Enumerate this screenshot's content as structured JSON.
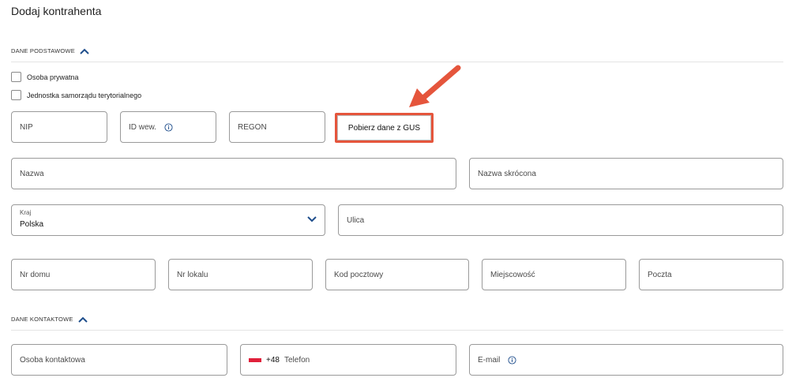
{
  "page": {
    "title": "Dodaj kontrahenta"
  },
  "sections": {
    "basic": {
      "label": "DANE PODSTAWOWE"
    },
    "contact": {
      "label": "DANE KONTAKTOWE"
    }
  },
  "checkboxes": {
    "private_person": {
      "label": "Osoba prywatna",
      "checked": false
    },
    "local_gov_unit": {
      "label": "Jednostka samorządu terytorialnego",
      "checked": false
    }
  },
  "fields": {
    "nip": {
      "placeholder": "NIP",
      "value": ""
    },
    "internal_id": {
      "placeholder": "ID wew.",
      "value": ""
    },
    "regon": {
      "placeholder": "REGON",
      "value": ""
    },
    "name": {
      "placeholder": "Nazwa",
      "value": ""
    },
    "short_name": {
      "placeholder": "Nazwa skrócona",
      "value": ""
    },
    "country": {
      "label": "Kraj",
      "value": "Polska"
    },
    "street": {
      "placeholder": "Ulica",
      "value": ""
    },
    "house_no": {
      "placeholder": "Nr domu",
      "value": ""
    },
    "flat_no": {
      "placeholder": "Nr lokalu",
      "value": ""
    },
    "postal_code": {
      "placeholder": "Kod pocztowy",
      "value": ""
    },
    "city": {
      "placeholder": "Miejscowość",
      "value": ""
    },
    "post_office": {
      "placeholder": "Poczta",
      "value": ""
    },
    "contact_person": {
      "placeholder": "Osoba kontaktowa",
      "value": ""
    },
    "phone": {
      "prefix": "+48",
      "placeholder": "Telefon",
      "value": ""
    },
    "email": {
      "placeholder": "E-mail",
      "value": ""
    }
  },
  "buttons": {
    "gus": {
      "label": "Pobierz dane z GUS"
    }
  },
  "icons": {
    "section_toggle": "chevron-up-icon",
    "select_caret": "chevron-down-icon",
    "info": "info-icon",
    "flag": "poland-flag-icon",
    "annotation": "red-arrow-annotation"
  },
  "colors": {
    "accent": "#1f4e8c",
    "highlight": "#e5553c",
    "border": "#9a9a9a",
    "flag_red": "#e0203a"
  }
}
